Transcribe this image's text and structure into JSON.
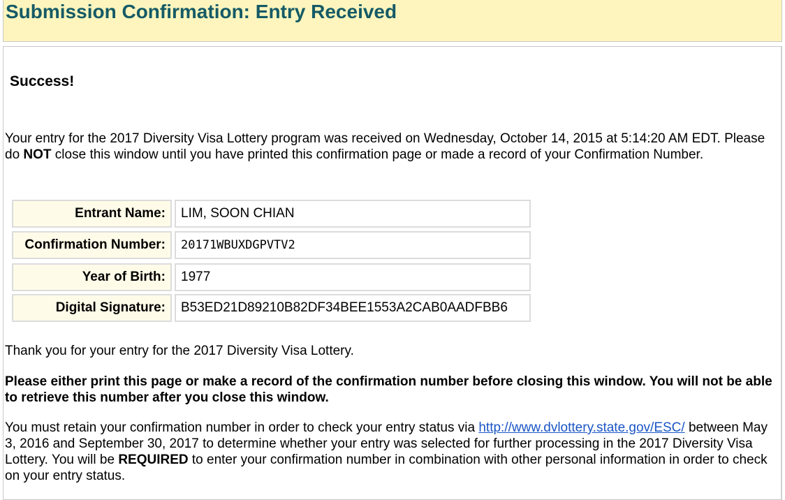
{
  "header": {
    "title": "Submission Confirmation: Entry Received"
  },
  "success": {
    "title": "Success!"
  },
  "intro": {
    "text1": "Your entry for the 2017 Diversity Visa Lottery program was received on Wednesday, October 14, 2015 at 5:14:20 AM EDT. Please do ",
    "strong": "NOT",
    "text2": " close this window until you have printed this confirmation page or made a record of your Confirmation Number."
  },
  "entry": {
    "name_label": "Entrant Name:",
    "name_value": "LIM, SOON CHIAN",
    "confirmation_label": "Confirmation Number:",
    "confirmation_value": "20171WBUXDGPVTV2",
    "birth_label": "Year of Birth:",
    "birth_value": "1977",
    "signature_label": "Digital Signature:",
    "signature_value": "B53ED21D89210B82DF34BEE1553A2CAB0AADFBB6"
  },
  "thanks": "Thank you for your entry for the 2017 Diversity Visa Lottery.",
  "warning": "Please either print this page or make a record of the confirmation number before closing this window. You will not be able to retrieve this number after you close this window.",
  "retain": {
    "text1": "You must retain your confirmation number in order to check your entry status via ",
    "link": "http://www.dvlottery.state.gov/ESC/",
    "text2": " between May 3, 2016 and September 30, 2017 to determine whether your entry was selected for further processing in the 2017 Diversity Visa Lottery. You will be ",
    "strong": "REQUIRED",
    "text3": " to enter your confirmation number in combination with other personal information in order to check on your entry status."
  }
}
